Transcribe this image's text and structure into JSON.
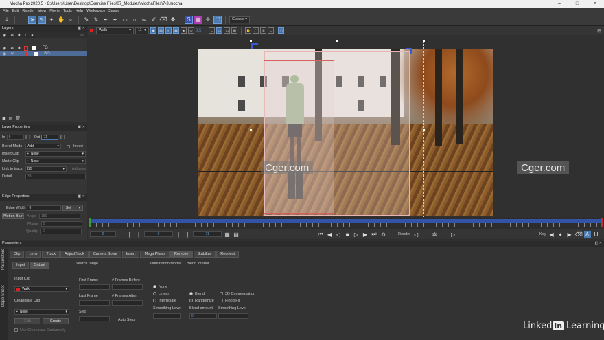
{
  "titlebar": {
    "title": "Mocha Pro 2020.5 - C:\\Users\\User\\Desktop\\Exercise Files\\07_Modules\\MochaFiles\\7-3.mocha"
  },
  "menu": [
    "File",
    "Edit",
    "Render",
    "View",
    "Movie",
    "Tools",
    "Help"
  ],
  "workspace": {
    "label": "Workspace: Classic"
  },
  "toolbar": {
    "classic": "Classic"
  },
  "viewbar": {
    "layer": "Walk",
    "zoom": "11",
    "value": "0.5"
  },
  "layers": {
    "title": "Layers",
    "items": [
      {
        "name": "FG"
      },
      {
        "name": "BG"
      }
    ]
  },
  "layer_props": {
    "title": "Layer Properties",
    "in_label": "In",
    "in_value": "0",
    "out_label": "Out",
    "out_value": "71",
    "blend_mode_label": "Blend Mode",
    "blend_mode_value": "Add",
    "invert": "Invert",
    "insert_clip_label": "Insert Clip",
    "insert_clip_value": "None",
    "matte_clip_label": "Matte Clip",
    "matte_clip_value": "None",
    "link_label": "Link to track",
    "link_value": "BG",
    "adjusted": "Adjusted",
    "detail_label": "Detail",
    "detail_value": "33"
  },
  "edge_props": {
    "title": "Edge Properties",
    "edge_width_label": "Edge Width",
    "edge_width_value": "0",
    "set": "Set",
    "motion_blur": "Motion Blur",
    "angle_label": "Angle",
    "angle_value": "180",
    "phase_label": "Phase",
    "phase_value": "0",
    "quality_label": "Quality",
    "quality_value": "0"
  },
  "watermarks": {
    "left": "Cger.com",
    "right": "Cger.com"
  },
  "transport": {
    "start": "0",
    "current": "0",
    "end": "71",
    "render": "Render",
    "key": "Key"
  },
  "params": {
    "title": "Parameters",
    "tabs": [
      "Clip",
      "Lens",
      "Track",
      "AdjustTrack",
      "Camera Solve",
      "Insert",
      "Mega Plates",
      "Remove",
      "Stabilize",
      "Reorient"
    ],
    "subtabs": [
      "Input",
      "Output"
    ],
    "side_tabs": [
      "Parameters",
      "Dope Sheet"
    ],
    "search_range": "Search range",
    "illumination_model": "Illumination Model",
    "blend_interior": "Blend Interior",
    "input_clip_label": "Input Clip",
    "input_clip_value": "Walk",
    "cleanplate_label": "Cleanplate Clip",
    "cleanplate_value": "None",
    "edit": "Edit",
    "create": "Create",
    "use_cleanplate": "Use Cleanplate Exclusively",
    "first_frame": "First Frame",
    "frames_before": "# Frames Before",
    "last_frame": "Last Frame",
    "frames_after": "# Frames After",
    "step": "Step",
    "auto_step": "Auto Step",
    "illum_none": "None",
    "illum_linear": "Linear",
    "illum_interpolate": "Interpolate",
    "smoothing_level": "Smoothing Level",
    "blend": "Blend",
    "randomize": "Randomize",
    "blend_amount": "Blend amount",
    "compensation": "3D Compensation",
    "flood_fill": "Flood Fill",
    "smoothing_level2": "Smoothing Level"
  },
  "branding": {
    "text1": "Linked",
    "badge": "in",
    "text2": "Learning"
  }
}
